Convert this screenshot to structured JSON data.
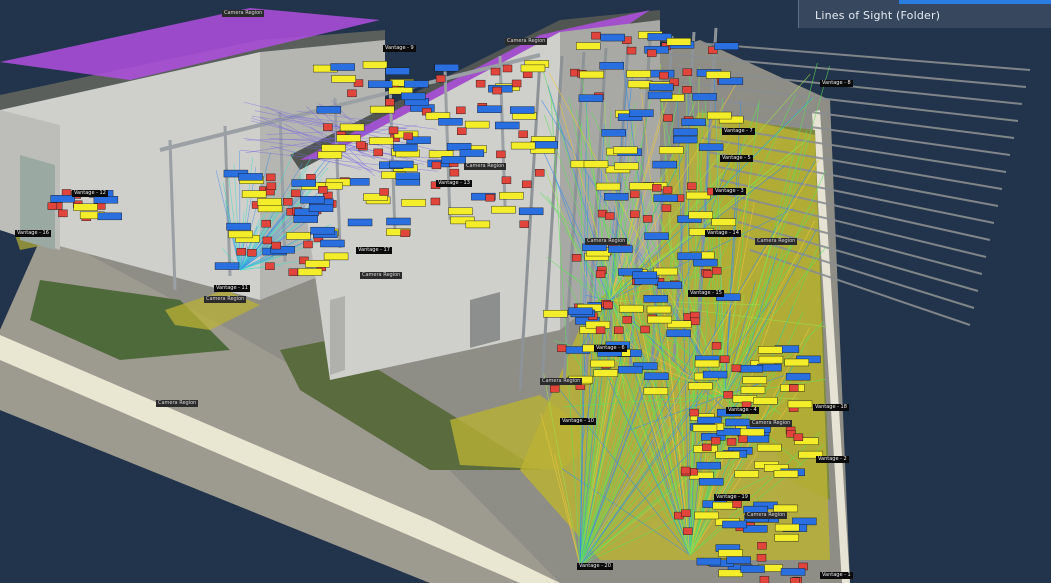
{
  "panel": {
    "title": "Lines of Sight (Folder)",
    "accent_color": "#2a7de1"
  },
  "colors": {
    "water": "#1d2f44",
    "roof_purple": "#b04fe0",
    "building": "#cfcfcc",
    "ground_yellow": "#b9b235",
    "tag_red": "#e0443b",
    "tag_yellow": "#f4ee2a",
    "tag_blue": "#2a6fe0",
    "ray_green": "#5ee05a",
    "ray_blue": "#3a8ee8"
  },
  "labels": [
    {
      "text": "Camera Region"
    },
    {
      "text": "Camera Region"
    },
    {
      "text": "Camera Region"
    },
    {
      "text": "Camera Region"
    },
    {
      "text": "Camera Region"
    },
    {
      "text": "Camera Region"
    },
    {
      "text": "Camera Region"
    },
    {
      "text": "Camera Region"
    },
    {
      "text": "Camera Region"
    },
    {
      "text": "Camera Region"
    },
    {
      "text": "Camera Region"
    },
    {
      "text": "Vantage - 8"
    },
    {
      "text": "Vantage - 7"
    },
    {
      "text": "Vantage - 5"
    },
    {
      "text": "Vantage - 3"
    },
    {
      "text": "Vantage - 14"
    },
    {
      "text": "Vantage - 12"
    },
    {
      "text": "Vantage - 15"
    },
    {
      "text": "Vantage - 18"
    },
    {
      "text": "Vantage - 13"
    },
    {
      "text": "Vantage - 16"
    },
    {
      "text": "Vantage - 11"
    },
    {
      "text": "Vantage - 6"
    },
    {
      "text": "Vantage - 9"
    },
    {
      "text": "Vantage - 4"
    },
    {
      "text": "Vantage - 17"
    },
    {
      "text": "Vantage - 10"
    },
    {
      "text": "Vantage - 19"
    },
    {
      "text": "Vantage - 2"
    },
    {
      "text": "Vantage - 20"
    },
    {
      "text": "Vantage - 1"
    }
  ]
}
